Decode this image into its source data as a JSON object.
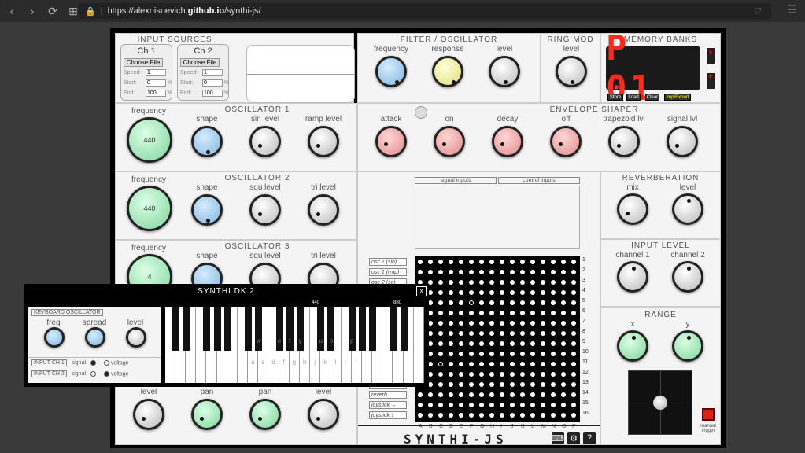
{
  "browser": {
    "url_prefix": "https://alexnisnevich.",
    "url_domain": "github.io",
    "url_path": "/synthi-js/"
  },
  "sections": {
    "input_sources": "INPUT SOURCES",
    "filter": "FILTER / OSCILLATOR",
    "ring_mod": "RING MOD",
    "memory": "MEMORY BANKS",
    "osc1": "OSCILLATOR 1",
    "osc2": "OSCILLATOR 2",
    "osc3": "OSCILLATOR 3",
    "envelope": "ENVELOPE SHAPER",
    "reverb": "REVERBERATION",
    "input_level": "INPUT LEVEL",
    "range": "RANGE"
  },
  "input_sources": {
    "channels": [
      {
        "name": "Ch 1",
        "file_button": "Choose File",
        "speed": "1",
        "start": "0",
        "end": "100"
      },
      {
        "name": "Ch 2",
        "file_button": "Choose File",
        "speed": "1",
        "start": "0",
        "end": "100"
      }
    ],
    "labels": {
      "speed": "Speed:",
      "start": "Start:",
      "end": "End:",
      "pct": "%"
    }
  },
  "knob_labels": {
    "frequency": "frequency",
    "response": "response",
    "level": "level",
    "shape": "shape",
    "sin_level": "sin level",
    "ramp_level": "ramp level",
    "squ_level": "squ level",
    "tri_level": "tri level",
    "attack": "attack",
    "on": "on",
    "decay": "decay",
    "off": "off",
    "trapezoid": "trapezoid lvl",
    "signal": "signal lvl",
    "mix": "mix",
    "channel1": "channel 1",
    "channel2": "channel 2",
    "x": "x",
    "y": "y",
    "pan": "pan",
    "spread": "spread",
    "freq": "freq"
  },
  "osc_values": {
    "osc1": "440",
    "osc2": "440",
    "osc3": "4"
  },
  "memory": {
    "display": "P 01",
    "buttons": [
      "Store",
      "Load",
      "Clear",
      "Imp/Export"
    ]
  },
  "matrix": {
    "signal_inputs": "signal inputs",
    "control_inputs": "control inputs",
    "rows": [
      "osc 1 (sin)",
      "osc 1 (rmp)",
      "osc 2 (sq)",
      "",
      "",
      "",
      "",
      "",
      "",
      "",
      "",
      "",
      "",
      "reverb",
      "joystick ↔",
      "joystick ↕"
    ],
    "row_numbers": [
      "1",
      "2",
      "3",
      "4",
      "5",
      "6",
      "7",
      "8",
      "9",
      "10",
      "11",
      "12",
      "13",
      "14",
      "15",
      "16"
    ],
    "col_letters": [
      "A",
      "B",
      "C",
      "D",
      "E",
      "F",
      "G",
      "H",
      "I",
      "J",
      "K",
      "L",
      "M",
      "N",
      "O",
      "P"
    ]
  },
  "logo": "SYNTHI-JS",
  "manual_trigger": "manual trigger",
  "dk": {
    "title": "SYNTHI DK.2",
    "close": "X",
    "kb_title": "KEYBOARD OSCILLATOR",
    "in1": "INPUT CH 1",
    "in2": "INPUT CH 2",
    "signal": "signal",
    "voltage": "voltage",
    "mark1": "440",
    "mark2": "880",
    "upper_keys": [
      "w",
      "e",
      "t",
      "y",
      "u",
      "o",
      "p"
    ],
    "lower_keys": [
      "a",
      "s",
      "d",
      "f",
      "g",
      "h",
      "j",
      "k",
      "l",
      ";",
      "'"
    ]
  }
}
